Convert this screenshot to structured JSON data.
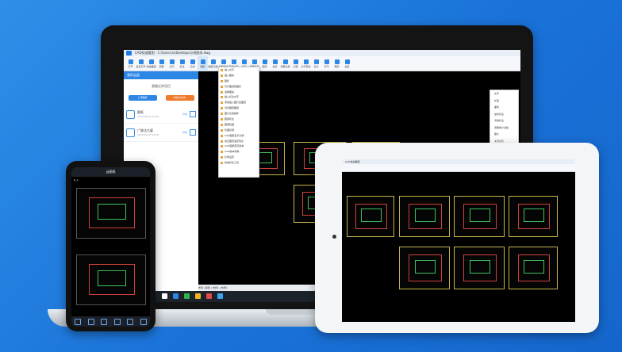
{
  "laptop": {
    "window_title": "CAD快速看图 - C:\\Users\\iv\\Desktop\\示例图纸.dwg",
    "toolbar": [
      "打开",
      "最近打开",
      "快速看图",
      "测量",
      "文字",
      "标注",
      "云线",
      "图层",
      "图纸比较",
      "编辑模式",
      "查找文字",
      "文字",
      "测量长度",
      "面积",
      "坐标",
      "测量比例",
      "分图",
      "文字查找",
      "对比",
      "打印",
      "帮助",
      "会员"
    ],
    "sidebar": {
      "header": "我的云盘",
      "title": "我最近的项目",
      "btn_upload": "上传图纸",
      "btn_new": "新建文件夹",
      "files": [
        {
          "name": "图纸",
          "meta": "2018-09-20 12:36",
          "action": "分享"
        },
        {
          "name": "广联达大厦",
          "meta": "2018-09-20 12:36",
          "action": "分享"
        }
      ]
    },
    "menu_items": [
      "插入文字",
      "插入图块",
      "图标",
      "对齐图纸和图标",
      "选择图案",
      "插入标注文字",
      "添加插入图片至图纸",
      "对比图纸图层",
      "图片比较插件",
      "图层标注",
      "图层隐藏",
      "隐藏标题",
      "CAD图纸显示比例",
      "常见图纸速查列表",
      "CAD图纸转高版本",
      "CAD版本转换",
      "比例设置",
      "快速标注工具"
    ],
    "right_panel": [
      "文字",
      "长度",
      "面积",
      "坐标标注",
      "清除标注",
      "测量统计表格",
      "图片",
      "文字对齐"
    ],
    "tabs": "布局  |  模型  |  布局1  |  布局2"
  },
  "tablet": {
    "window_title": "CAD快速看图"
  },
  "phone": {
    "title": "云图纸",
    "corner_label": "N_A"
  },
  "colors": {
    "accent": "#2b86e6",
    "orange": "#f07b2c",
    "cad_frame": "#c6b64a"
  }
}
